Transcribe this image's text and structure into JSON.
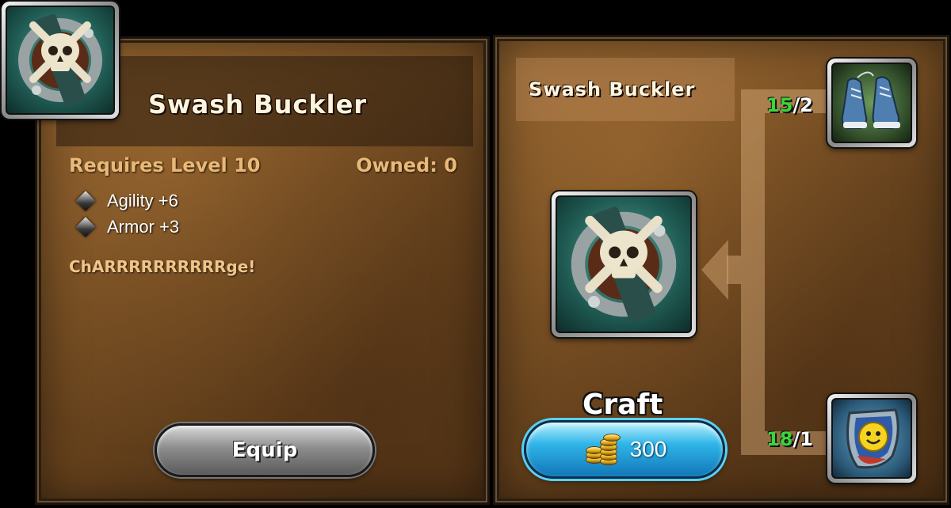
{
  "item": {
    "name": "Swash Buckler",
    "requires": "Requires Level 10",
    "owned": "Owned: 0",
    "stats": [
      "Agility +6",
      "Armor +3"
    ],
    "flavor": "ChARRRRRRRRRRge!",
    "icon": "skull-shield-icon"
  },
  "actions": {
    "equip_label": "Equip",
    "craft_label": "Craft",
    "craft_cost": "300",
    "cost_icon": "gold-coins-icon"
  },
  "recipe": {
    "title": "Swash Buckler",
    "components": [
      {
        "icon": "sneakers-icon",
        "have": "15",
        "need": "/2"
      },
      {
        "icon": "smiley-shield-icon",
        "have": "18",
        "need": "/1"
      }
    ]
  },
  "colors": {
    "have_count": "#3bd43b",
    "craft_button": "#2fb5e8",
    "label_gold": "#e8b978"
  }
}
